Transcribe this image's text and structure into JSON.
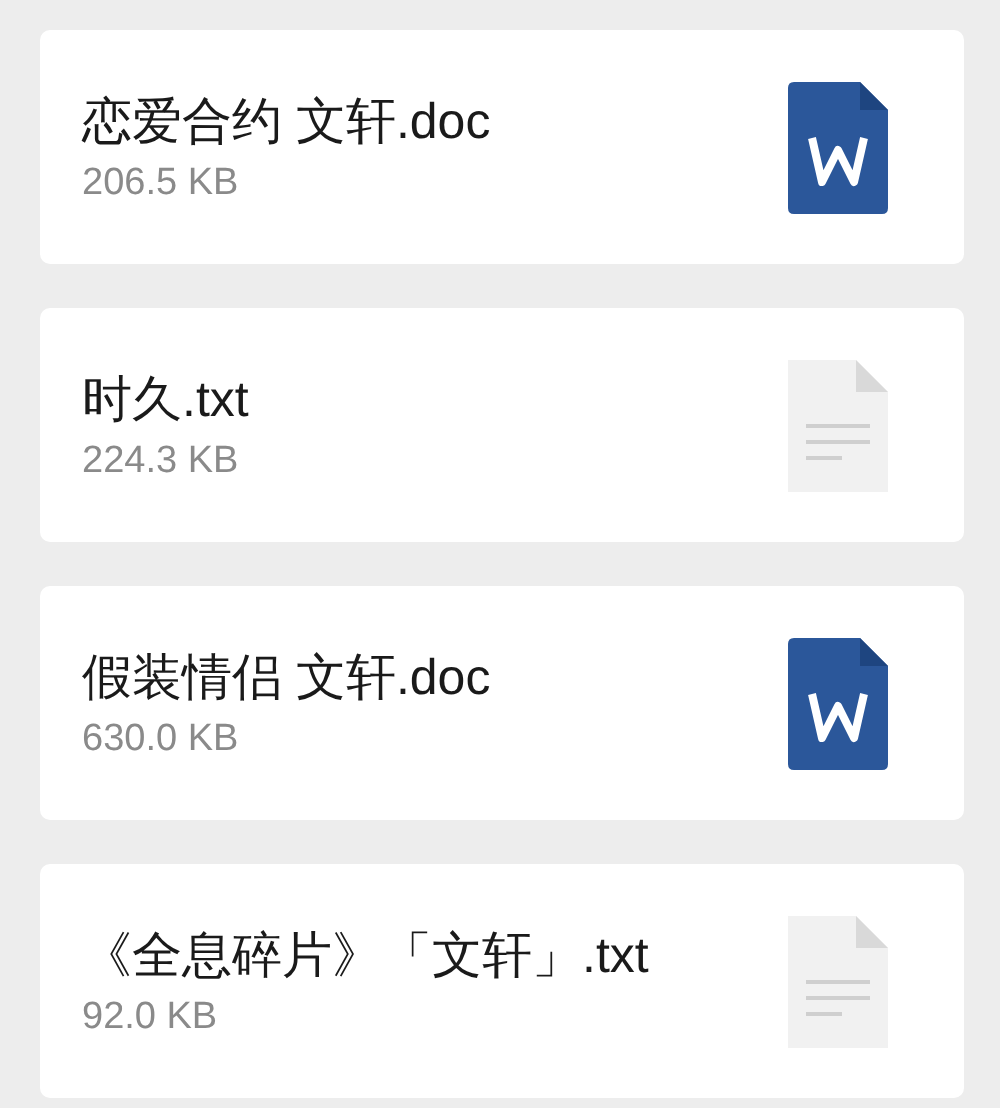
{
  "messages": [
    {
      "file_name": "恋爱合约 文轩.doc",
      "file_size": "206.5 KB",
      "kind": "word"
    },
    {
      "file_name": "时久.txt",
      "file_size": "224.3 KB",
      "kind": "text"
    },
    {
      "file_name": "假装情侣 文轩.doc",
      "file_size": "630.0 KB",
      "kind": "word"
    },
    {
      "file_name": "《全息碎片》「文轩」.txt",
      "file_size": "92.0 KB",
      "kind": "text"
    }
  ]
}
